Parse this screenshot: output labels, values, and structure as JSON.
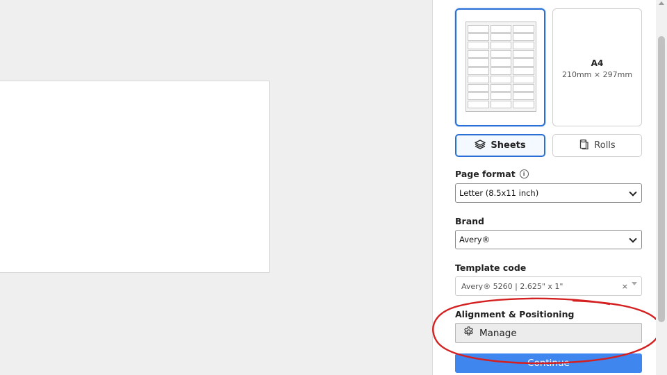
{
  "layout_cards": {
    "a4": {
      "title": "A4",
      "dimensions": "210mm × 297mm"
    }
  },
  "media_type": {
    "sheets_label": "Sheets",
    "rolls_label": "Rolls",
    "selected": "Sheets"
  },
  "page_format": {
    "label": "Page format",
    "value": "Letter (8.5x11 inch)"
  },
  "brand": {
    "label": "Brand",
    "value": "Avery®"
  },
  "template_code": {
    "label": "Template code",
    "value": "Avery® 5260 | 2.625\" x 1\"",
    "clear_symbol": "×"
  },
  "alignment": {
    "label": "Alignment & Positioning",
    "manage_label": "Manage"
  },
  "continue_label": "Continue",
  "colors": {
    "accent": "#2a6fd6",
    "primary_button": "#3f86ee",
    "highlight_ellipse": "#d42020"
  },
  "icons": {
    "info": "info-circle-icon",
    "sheets": "stack-sheets-icon",
    "rolls": "paper-roll-icon",
    "manage": "gear-icon",
    "dropdown": "chevron-down-icon"
  }
}
